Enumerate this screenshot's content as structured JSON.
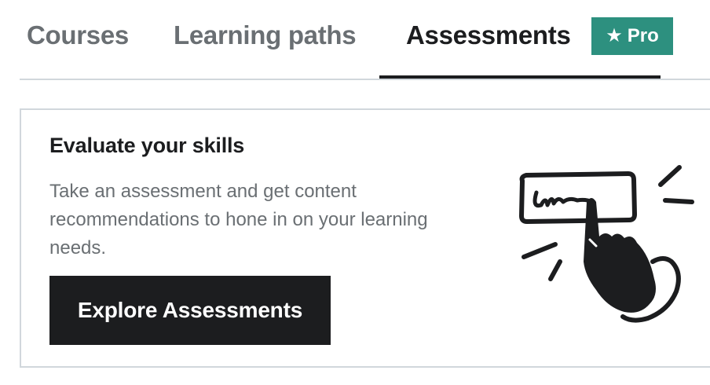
{
  "tabs": [
    {
      "label": "Courses",
      "active": false
    },
    {
      "label": "Learning paths",
      "active": false
    },
    {
      "label": "Assessments",
      "active": true
    }
  ],
  "pro_badge": {
    "icon": "star-icon",
    "label": "Pro",
    "color": "#2d907f"
  },
  "card": {
    "title": "Evaluate your skills",
    "description": "Take an assessment and get content recommendations to hone in on your learning needs.",
    "button_label": "Explore Assessments",
    "illustration": "hand-clicking-button-icon"
  },
  "colors": {
    "text_dark": "#1c1d1f",
    "text_muted": "#6a6f73",
    "border": "#d1d7dc",
    "accent": "#2d907f"
  }
}
